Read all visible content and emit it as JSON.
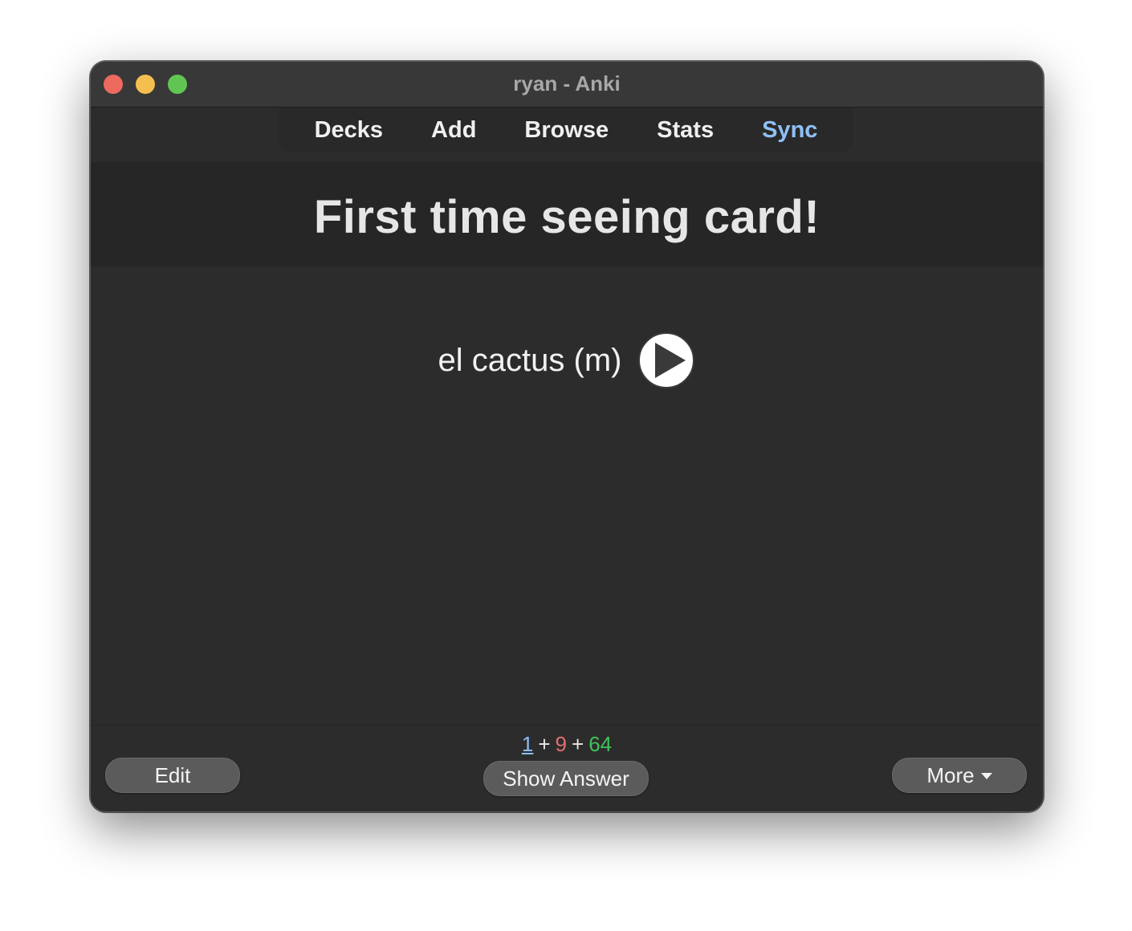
{
  "window": {
    "title": "ryan - Anki"
  },
  "toolbar": {
    "items": [
      {
        "label": "Decks"
      },
      {
        "label": "Add"
      },
      {
        "label": "Browse"
      },
      {
        "label": "Stats"
      },
      {
        "label": "Sync"
      }
    ],
    "active_color": "#8fc0f7"
  },
  "header": {
    "title": "First time seeing card!"
  },
  "card": {
    "front_text": "el cactus (m)",
    "play_icon": "play-icon"
  },
  "bottom_bar": {
    "counts": {
      "new": "1",
      "learning": "9",
      "review": "64",
      "separator": "+",
      "colors": {
        "new": "#8fbcf5",
        "learning": "#e36f6f",
        "review": "#3fc35a"
      }
    },
    "edit_label": "Edit",
    "show_answer_label": "Show Answer",
    "more_label": "More"
  }
}
